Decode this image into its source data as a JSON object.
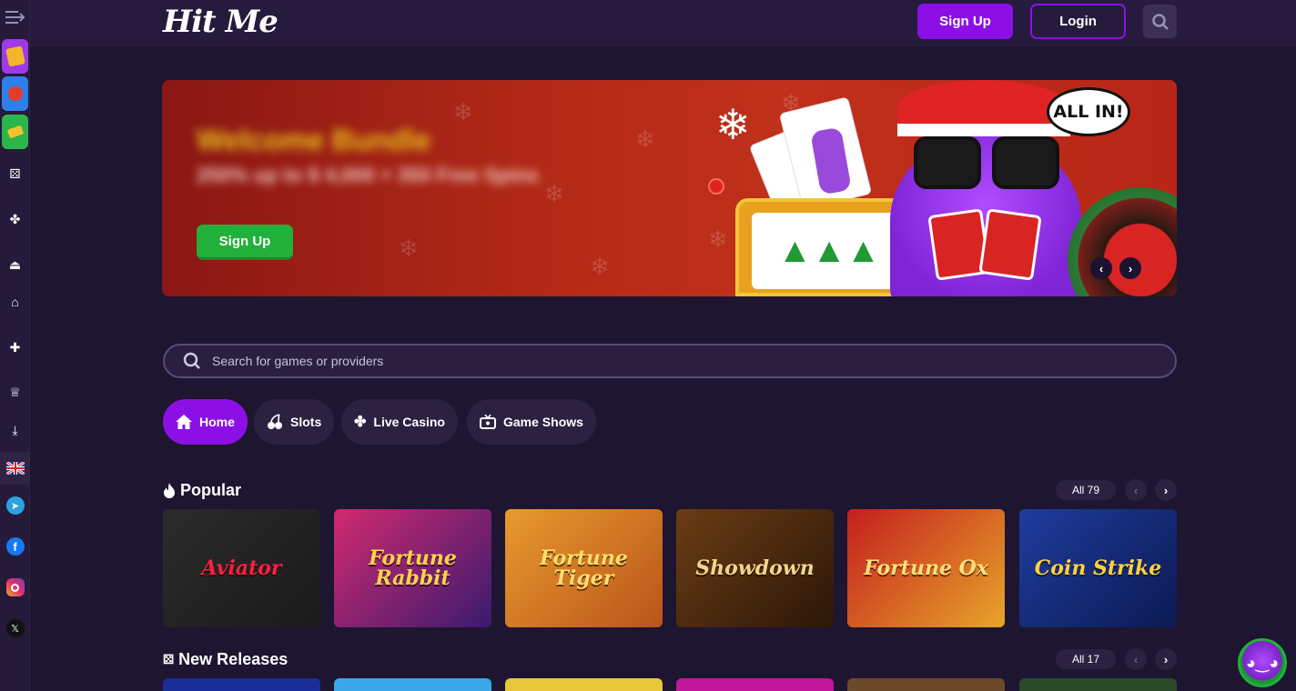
{
  "brand": {
    "logo": "Hit Me"
  },
  "header": {
    "signup_label": "Sign Up",
    "login_label": "Login"
  },
  "banner": {
    "title": "Welcome Bundle",
    "subtitle": "250% up to $ 4,000 + 350 Free Spins",
    "cta_label": "Sign Up",
    "bubble_text": "ALL IN!"
  },
  "search": {
    "placeholder": "Search for games or providers"
  },
  "tabs": [
    {
      "label": "Home",
      "icon": "home-icon",
      "active": true
    },
    {
      "label": "Slots",
      "icon": "cherries-icon"
    },
    {
      "label": "Live Casino",
      "icon": "chips-icon"
    },
    {
      "label": "Game Shows",
      "icon": "tv-icon"
    }
  ],
  "sections": {
    "popular": {
      "title": "Popular",
      "icon": "flame-icon",
      "all_label": "All 79",
      "games": [
        {
          "name": "Aviator",
          "colors": [
            "#2b2b2b",
            "#1a1a1a"
          ],
          "text_color": "#ff1f3d"
        },
        {
          "name": "Fortune Rabbit",
          "colors": [
            "#d02a6f",
            "#3a1a6e"
          ],
          "text_color": "#ffd34a"
        },
        {
          "name": "Fortune Tiger",
          "colors": [
            "#e89a2e",
            "#b9541a"
          ],
          "text_color": "#ffdf6a"
        },
        {
          "name": "Showdown",
          "colors": [
            "#6a3c14",
            "#2c1708"
          ],
          "text_color": "#f4d48a"
        },
        {
          "name": "Fortune Ox",
          "colors": [
            "#c41e1e",
            "#e7a52a"
          ],
          "text_color": "#ffe07a"
        },
        {
          "name": "Coin Strike",
          "colors": [
            "#1f3c9e",
            "#0b1a52"
          ],
          "text_color": "#ffd23a"
        }
      ]
    },
    "new_releases": {
      "title": "New Releases",
      "icon": "dice-icon",
      "all_label": "All 17"
    }
  },
  "new_release_thumbs": [
    "#1a2e9a",
    "#3aa8e8",
    "#e8c83a",
    "#c2179a",
    "#6a4a2a",
    "#2a4a2a"
  ],
  "colors": {
    "accent": "#8c0fe6",
    "green": "#22b03a",
    "bg": "#1e1530"
  }
}
